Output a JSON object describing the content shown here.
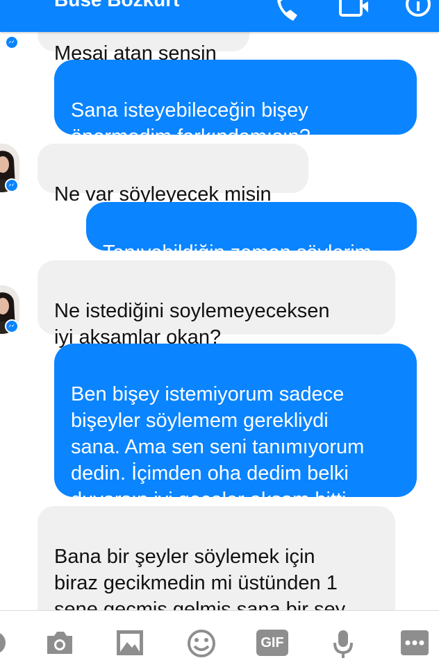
{
  "header": {
    "contact_name": "Buse Bozkurt",
    "accent_color": "#0a84ff",
    "icons": [
      "phone-icon",
      "video-call-icon",
      "info-icon"
    ]
  },
  "messages": [
    {
      "direction": "incoming",
      "text": "Mesaj atan sensin"
    },
    {
      "direction": "outgoing",
      "text": "Sana isteyebileceğin bişey\nönermedim farkındamısın?"
    },
    {
      "direction": "incoming",
      "text": "Ne var söyleyecek misin"
    },
    {
      "direction": "outgoing",
      "text": "Tanıyabildiğin zaman söylerim"
    },
    {
      "direction": "incoming",
      "text": "Ne istediğini soylemeyeceksen\niyi akşamlar okan?"
    },
    {
      "direction": "outgoing",
      "text": "Ben bişey istemiyorum sadece\nbişeyler söylemem gerekliydi\nsana. Ama sen seni tanımıyorum\ndedin. İçimden oha dedim belki\nduyarsın iyi geceler akşam bitti"
    },
    {
      "direction": "incoming",
      "text": "Bana bir şeyler söylemek için\nbiraz gecikmedin mi üstünden 1\nsene geçmiş gelmiş sana bir şey\nsoylucem diyosun ?"
    }
  ],
  "composer": {
    "gif_label": "GIF",
    "icon_color": "#8e8e8e",
    "icons": [
      "menu-icon",
      "camera-icon",
      "gallery-icon",
      "emoji-icon",
      "gif-icon",
      "microphone-icon",
      "more-icon"
    ]
  }
}
